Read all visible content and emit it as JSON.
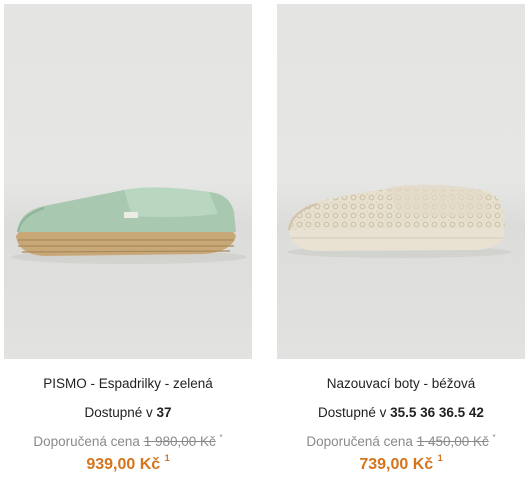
{
  "colors": {
    "price": "#d5741c",
    "rrp_text": "#8a8a8a",
    "text": "#222222",
    "photo_bg": "#e4e4e2"
  },
  "products": [
    {
      "image": "espadrille-green-shoe-photo",
      "title": "PISMO - Espadrilky - zelená",
      "availability_label": "Dostupné v",
      "sizes": "37",
      "rrp_label": "Doporučená cena",
      "rrp_value": "1 980,00 Kč",
      "rrp_note": "*",
      "price": "939,00 Kč",
      "price_note": "1"
    },
    {
      "image": "lace-slip-on-beige-shoe-photo",
      "title": "Nazouvací boty - béžová",
      "availability_label": "Dostupné v",
      "sizes": "35.5 36 36.5 42",
      "rrp_label": "Doporučená cena",
      "rrp_value": "1 450,00 Kč",
      "rrp_note": "*",
      "price": "739,00 Kč",
      "price_note": "1"
    }
  ]
}
